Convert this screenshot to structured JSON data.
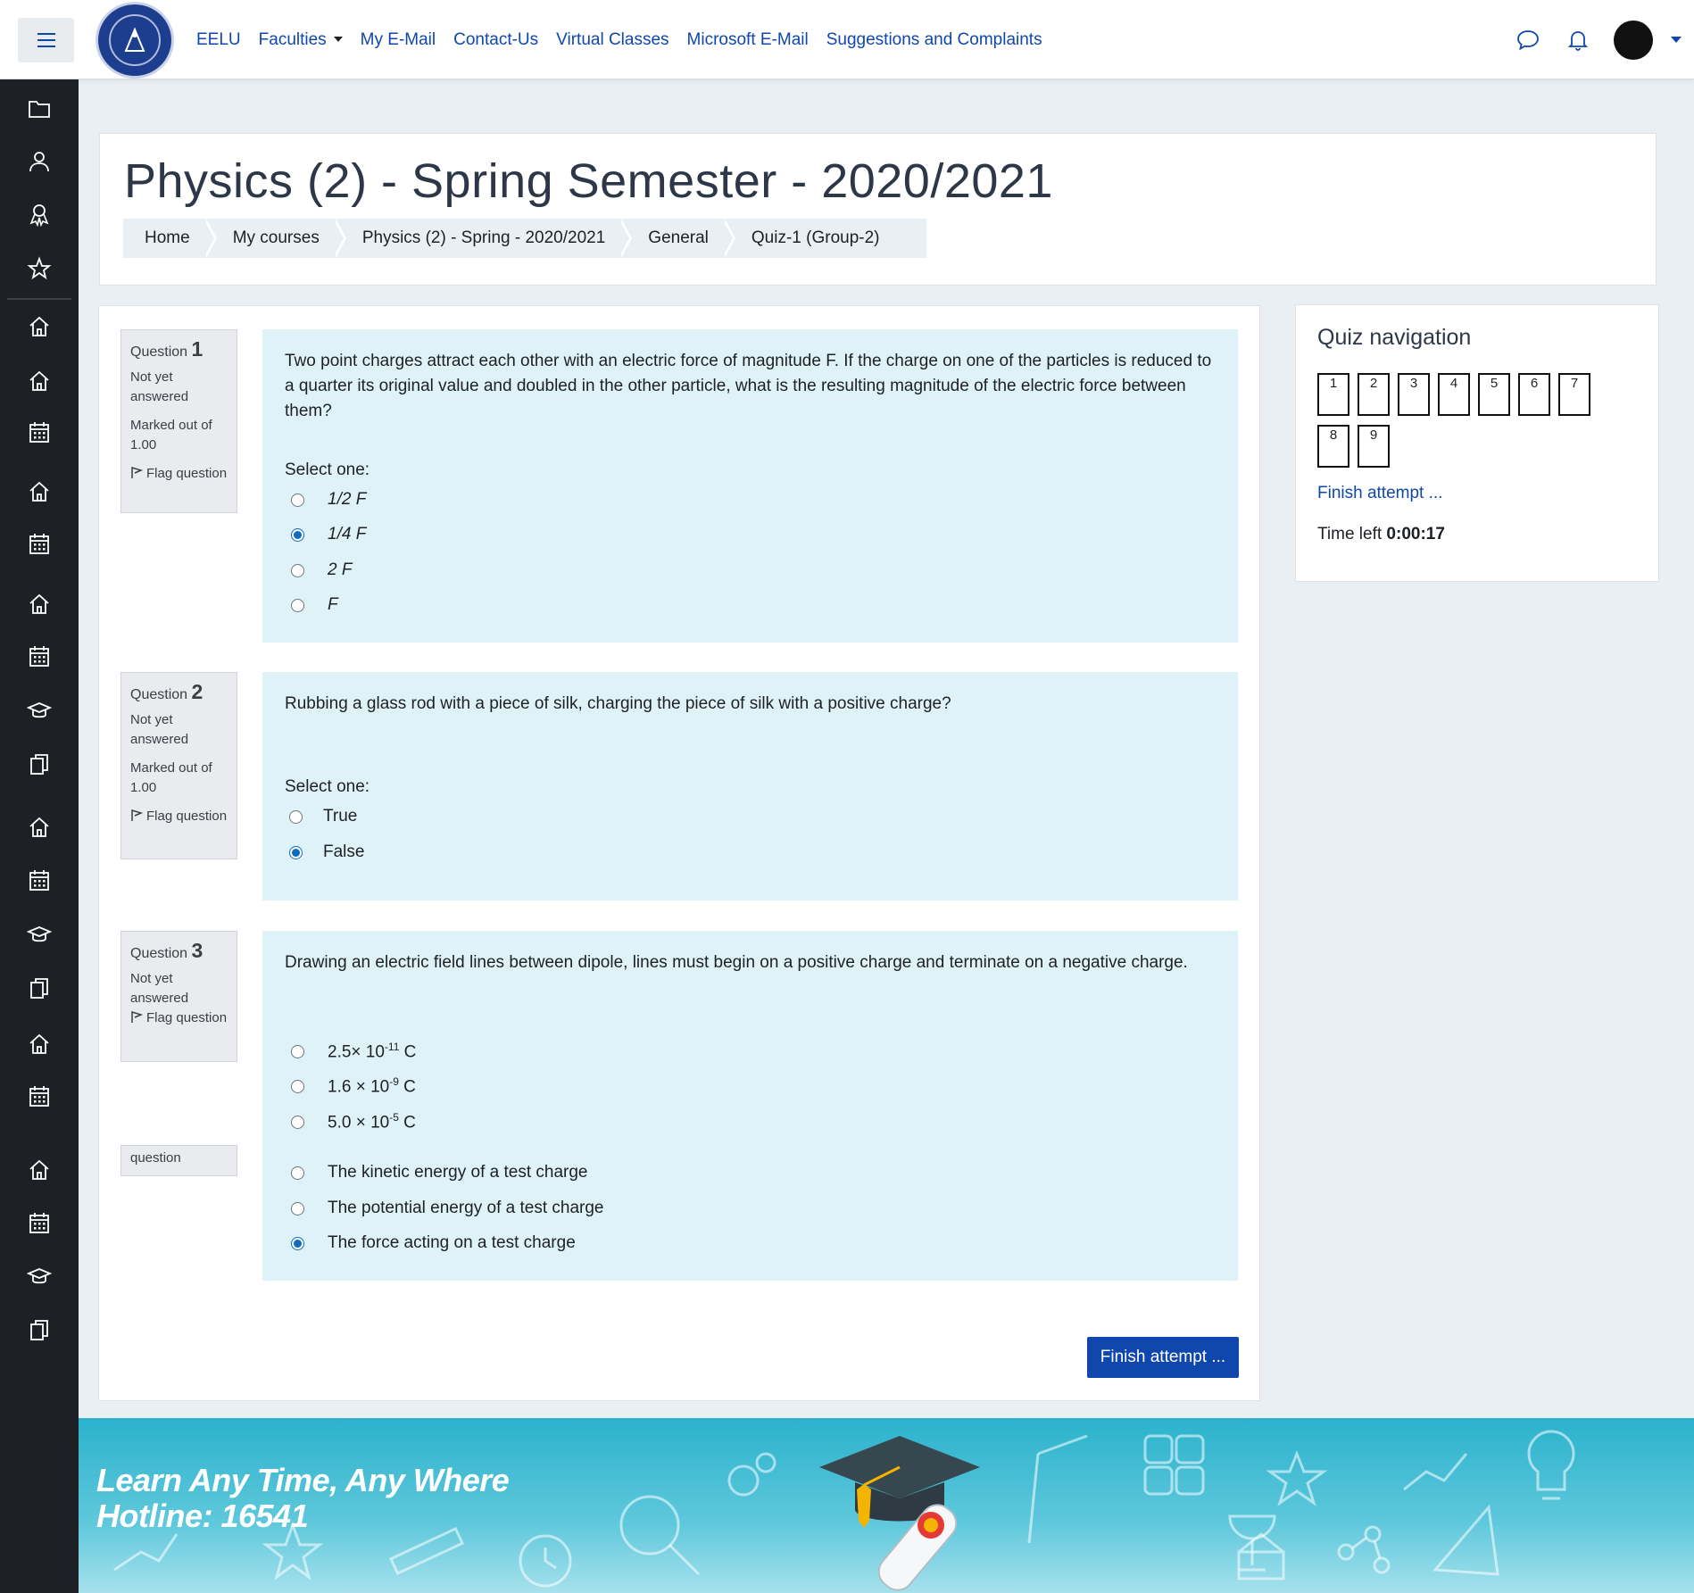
{
  "navbar": {
    "links": [
      "EELU",
      "Faculties",
      "My E-Mail",
      "Contact-Us",
      "Virtual Classes",
      "Microsoft E-Mail",
      "Suggestions and Complaints"
    ]
  },
  "header": {
    "title": "Physics (2) - Spring Semester - 2020/2021",
    "breadcrumb": [
      "Home",
      "My courses",
      "Physics (2) - Spring - 2020/2021",
      "General",
      "Quiz-1 (Group-2)"
    ]
  },
  "questions": [
    {
      "label": "Question",
      "number": "1",
      "state": "Not yet answered",
      "grade": "Marked out of 1.00",
      "flag": "Flag question",
      "text": "Two point charges attract each other with an electric force of magnitude F. If the charge on one of the particles is reduced to a quarter its original value and doubled in the other particle, what is the resulting magnitude of the electric force between them?",
      "select_label": "Select one:",
      "options": [
        "1/2 F",
        "1/4 F",
        "2 F",
        "F"
      ],
      "selected": 1
    },
    {
      "label": "Question",
      "number": "2",
      "state": "Not yet answered",
      "grade": "Marked out of 1.00",
      "flag": "Flag question",
      "text": "Rubbing a glass rod with a piece of silk, charging the piece of silk with a positive charge?",
      "select_label": "Select one:",
      "options": [
        "True",
        "False"
      ],
      "selected": 1
    },
    {
      "label": "Question",
      "number": "3",
      "state": "Not yet answered",
      "flag": "Flag question",
      "text": "Drawing an electric field lines between dipole, lines must begin on a positive charge and terminate on a negative charge.",
      "options": [
        "2.5× 10",
        "1.6 × 10",
        "5.0 × 10"
      ],
      "exponents": [
        "-11",
        "-9",
        "-5"
      ],
      "unit": "C"
    },
    {
      "flag_tail": "question",
      "options": [
        "The kinetic energy of a test charge",
        "The potential energy of a test charge",
        "The force acting on a test charge"
      ],
      "selected": 2
    }
  ],
  "finish_button": "Finish attempt ...",
  "quiz_nav": {
    "title": "Quiz navigation",
    "buttons": [
      "1",
      "2",
      "3",
      "4",
      "5",
      "6",
      "7",
      "8",
      "9"
    ],
    "finish_link": "Finish attempt ...",
    "time_label": "Time left",
    "time_value": "0:00:17"
  },
  "footer": {
    "line1": "Learn Any Time, Any Where",
    "line2": "Hotline: 16541"
  },
  "colors": {
    "brand": "#0f47ad",
    "sidebar": "#1d2125",
    "question_bg": "#def2f8",
    "footer": "#2bb2cc"
  }
}
